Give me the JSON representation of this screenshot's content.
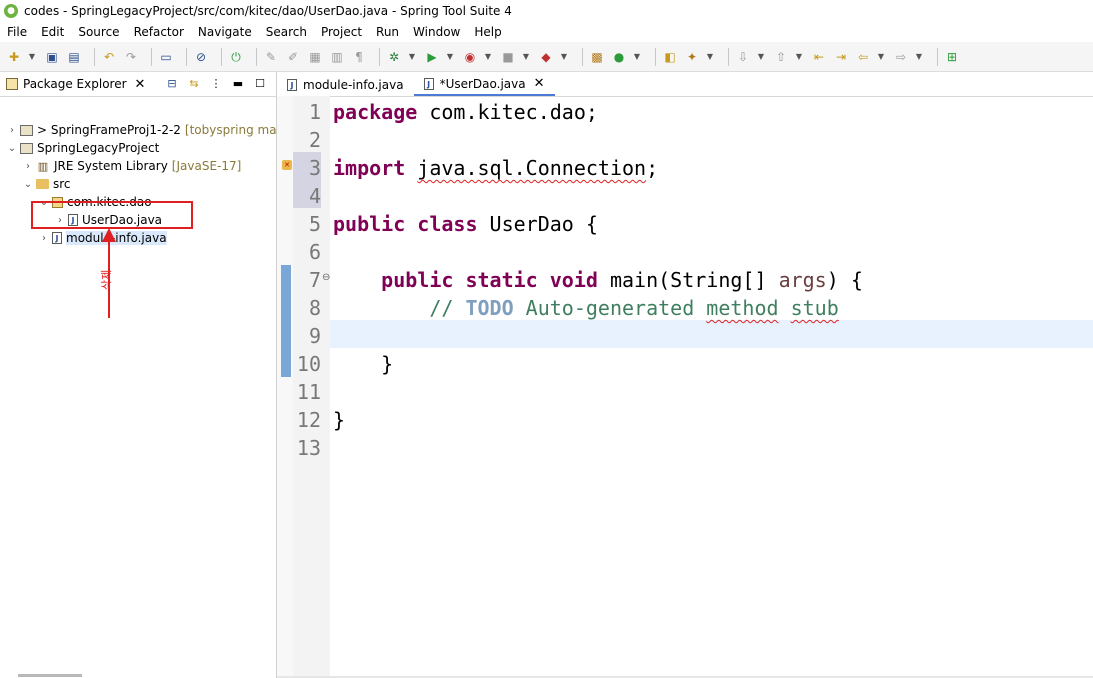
{
  "window": {
    "title": "codes - SpringLegacyProject/src/com/kitec/dao/UserDao.java - Spring Tool Suite 4"
  },
  "menu": [
    "File",
    "Edit",
    "Source",
    "Refactor",
    "Navigate",
    "Search",
    "Project",
    "Run",
    "Window",
    "Help"
  ],
  "explorer": {
    "tab_label": "Package Explorer",
    "close_glyph": "✕",
    "items": [
      {
        "chevron": "›",
        "label": "> SpringFrameProj1-2-2",
        "decoration": "[tobyspring main]"
      },
      {
        "chevron": "⌄",
        "label": "SpringLegacyProject"
      },
      {
        "chevron": "›",
        "label": "JRE System Library",
        "decoration": "[JavaSE-17]"
      },
      {
        "chevron": "⌄",
        "label": "src"
      },
      {
        "chevron": "⌄",
        "label": "com.kitec.dao"
      },
      {
        "chevron": "›",
        "label": "UserDao.java"
      },
      {
        "chevron": "›",
        "label": "module-info.java"
      }
    ],
    "annotation": "삭제"
  },
  "editor": {
    "tabs": [
      {
        "label": "module-info.java"
      },
      {
        "label": "*UserDao.java",
        "close_glyph": "✕"
      }
    ],
    "line_numbers": [
      "1",
      "2",
      "3",
      "4",
      "5",
      "6",
      "7",
      "8",
      "9",
      "10",
      "11",
      "12",
      "13"
    ],
    "code": {
      "l1_kw": "package",
      "l1_rest": " com.kitec.dao;",
      "l3_kw": "import",
      "l3_sp": " ",
      "l3_sq": "java.sql.Connection",
      "l3_end": ";",
      "l5_kw1": "public",
      "l5_kw2": "class",
      "l5_rest": " UserDao {",
      "l7_kw1": "public",
      "l7_kw2": "static",
      "l7_kw3": "void",
      "l7_rest": " main(String[] ",
      "l7_args": "args",
      "l7_end": ") {",
      "l8_slash": "// ",
      "l8_todo": "TODO",
      "l8_a": " Auto-generated ",
      "l8_method": "method",
      "l8_sp": " ",
      "l8_stub": "stub",
      "l10": "}",
      "l12": "}"
    }
  },
  "colors": {
    "keyword": "#7f0055",
    "comment": "#3f7f5f",
    "todo": "#7f9fbf",
    "annotation": "#e02020",
    "tab_accent": "#4b7bd4"
  }
}
